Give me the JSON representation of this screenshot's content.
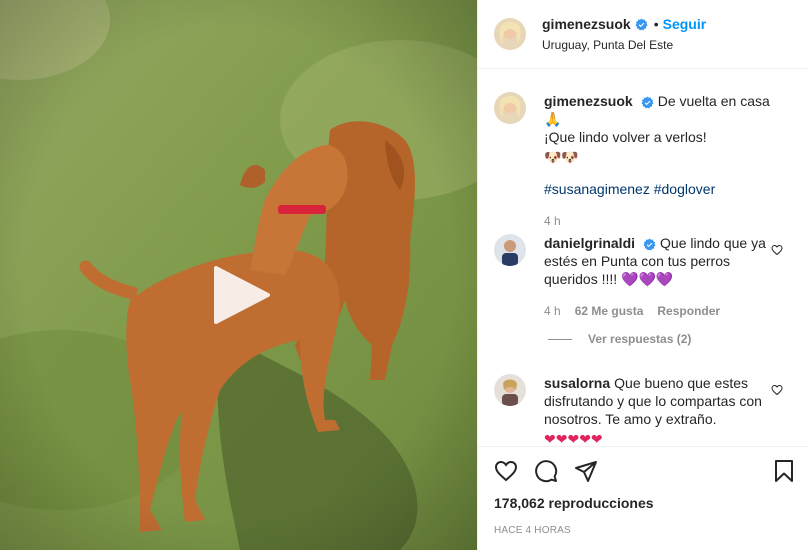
{
  "post": {
    "username": "gimenezsuok",
    "follow_label": "Seguir",
    "separator": "•",
    "location": "Uruguay, Punta Del Este"
  },
  "caption": {
    "username": "gimenezsuok",
    "text_line1": "De vuelta en casa 🙏",
    "text_line2": "¡Que lindo volver a verlos!",
    "emoji_line": "🐶🐶",
    "hashtags": "#susanagimenez #doglover",
    "time": "4 h"
  },
  "comments": [
    {
      "username": "danielgrinaldi",
      "text": "Que lindo que ya estés en Punta con tus perros queridos !!!!",
      "emoji": "💜💜💜",
      "time": "4 h",
      "likes": "62 Me gusta",
      "reply_label": "Responder",
      "view_replies": "Ver respuestas (2)"
    },
    {
      "username": "susalorna",
      "text": "Que bueno que estes disfrutando y que lo compartas con nosotros. Te amo y extraño.",
      "emoji": "❤❤❤❤❤"
    }
  ],
  "stats": {
    "views": "178,062 reproducciones",
    "timestamp": "HACE 4 HORAS"
  },
  "icons": {
    "like": "heart-icon",
    "comment": "comment-icon",
    "share": "share-icon",
    "save": "bookmark-icon",
    "play": "play-icon",
    "verified": "verified-badge-icon"
  },
  "colors": {
    "link": "#0095f6",
    "hashtag": "#00376b",
    "verified": "#3897f0",
    "muted": "#8e8e8e",
    "grass": "#7f9a4a"
  }
}
